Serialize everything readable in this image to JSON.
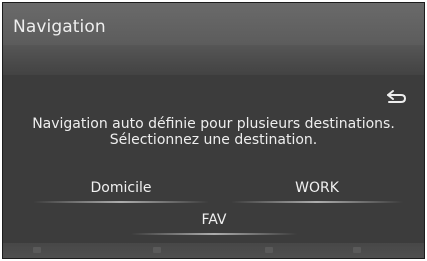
{
  "header": {
    "title": "Navigation"
  },
  "dialog": {
    "back_icon": "return-arrow-icon",
    "message_line1": "Navigation auto définie pour plusieurs destinations.",
    "message_line2": "Sélectionnez une destination.",
    "destinations": [
      {
        "label": "Domicile"
      },
      {
        "label": "WORK"
      },
      {
        "label": "FAV"
      }
    ]
  },
  "colors": {
    "background": "#3e3e3e",
    "header": "#616161",
    "text": "#eeeeee"
  }
}
